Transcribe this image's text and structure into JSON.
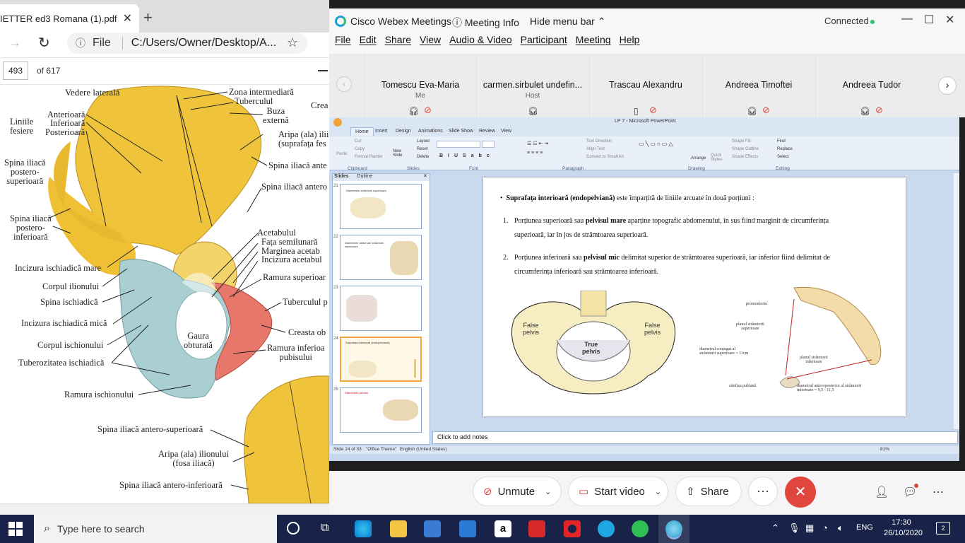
{
  "pdf_viewer": {
    "tab_title": "IETTER ed3 Romana (1).pdf",
    "close_icon": "close-icon",
    "new_tab": "+",
    "address_file_label": "File",
    "address_url": "C:/Users/Owner/Desktop/A...",
    "page_number": "493",
    "page_total": "of 617",
    "figure_labels": {
      "vedere_laterala": "Vedere laterală",
      "zona_intermediara": "Zona intermediară",
      "tuberculul": "Tuberculul",
      "creasta_partial": "Crea",
      "buza_externa": "Buza\nexternă",
      "liniile_fesiere": "Liniile\nfesiere",
      "anterioara": "Anterioară",
      "inferioara": "Inferioară",
      "posterioara": "Posterioară",
      "aripa_ilium_fesiera": "Aripa (ala) ilii\n(suprafața fes",
      "spina_post_sup": "Spina iliacă\npostero-\nsuperioară",
      "spina_ant_partial": "Spina iliacă ante",
      "spina_antero_partial": "Spina iliacă antero",
      "spina_post_inf": "Spina iliacă\npostero-\ninferioară",
      "acetabulul": "Acetabulul",
      "fata_semilunara": "Fața semilunară",
      "marginea_acetabulului": "Marginea acetab",
      "incizura_acetabulului": "Incizura acetabul",
      "incizura_ischiadica_mare": "Incizura ischiadică mare",
      "ramura_superioara": "Ramura superioar",
      "corpul_ilionului": "Corpul ilionului",
      "spina_ischiadica": "Spina ischiadică",
      "tuberculul_pubian": "Tuberculul p",
      "incizura_ischiadica_mica": "Incizura ischiadică mică",
      "creasta_pubiana": "Creasta ob",
      "gaura_obturata": "Gaura\nobturată",
      "corpul_ischionului": "Corpul ischionului",
      "ramura_inferioara": "Ramura inferioa\npubisului",
      "tuberozitatea_ischiadica": "Tuberozitatea ischiadică",
      "ramura_ischionului": "Ramura ischionului",
      "spina_antero_superioara": "Spina iliacă antero-superioară",
      "aripa_ilionului_fosa": "Aripa (ala) ilionului\n(fosa iliacă)",
      "spina_antero_inferioara": "Spina iliacă antero-inferioară"
    }
  },
  "webex": {
    "app_name": "Cisco Webex Meetings",
    "meeting_info": "Meeting Info",
    "hide_menu_bar": "Hide menu bar",
    "status": "Connected",
    "menu": [
      "File",
      "Edit",
      "Share",
      "View",
      "Audio & Video",
      "Participant",
      "Meeting",
      "Help"
    ],
    "participants": [
      {
        "name": "Tomescu Eva-Maria",
        "role": "Me",
        "icon": "headset-icon",
        "muted": true
      },
      {
        "name": "carmen.sirbulet undefin...",
        "role": "Host",
        "icon": "headset-share-icon",
        "muted": false
      },
      {
        "name": "Trascau Alexandru",
        "role": "",
        "icon": "phone-icon",
        "muted": true
      },
      {
        "name": "Andreea Timoftei",
        "role": "",
        "icon": "headset-icon",
        "muted": true
      },
      {
        "name": "Andreea Tudor",
        "role": "",
        "icon": "headset-icon",
        "muted": true
      }
    ],
    "controls": {
      "unmute": "Unmute",
      "start_video": "Start video",
      "share": "Share",
      "more": "···",
      "end_icon": "close-icon"
    }
  },
  "powerpoint": {
    "window_title": "LP 7 - Microsoft PowerPoint",
    "ribbon_tabs": [
      "Home",
      "Insert",
      "Design",
      "Animations",
      "Slide Show",
      "Review",
      "View"
    ],
    "ribbon_groups": [
      "Clipboard",
      "Slides",
      "Font",
      "Paragraph",
      "Drawing",
      "Editing"
    ],
    "ribbon_buttons": {
      "paste": "Paste",
      "cut": "Cut",
      "copy": "Copy",
      "format_painter": "Format Painter",
      "new_slide": "New\nSlide",
      "layout": "Layout",
      "reset": "Reset",
      "delete": "Delete",
      "text_direction": "Text Direction",
      "align_text": "Align Text",
      "convert_smartart": "Convert to SmartArt",
      "arrange": "Arrange",
      "quick_styles": "Quick\nStyles",
      "shape_fill": "Shape Fill",
      "shape_outline": "Shape Outline",
      "shape_effects": "Shape Effects",
      "find": "Find",
      "replace": "Replace",
      "select": "Select"
    },
    "pane_tabs": [
      "Slides",
      "Outline"
    ],
    "thumbnails": [
      {
        "num": "21",
        "title": "Diametrele strâmtorii superioare"
      },
      {
        "num": "22",
        "title": "Diametrele oblice ale strâmtorii superioare"
      },
      {
        "num": "23",
        "title": ""
      },
      {
        "num": "24",
        "title": "Suprafața interioară (endopelviană)",
        "selected": true
      },
      {
        "num": "25",
        "title": "Diferențele pelvine"
      }
    ],
    "slide": {
      "bullet": "•",
      "p1_bold": "Suprafața interioară (endopelviană)",
      "p1_rest": "este împarțită de liniile arcuate în două porțiuni :",
      "item1_num": "1.",
      "item1_a": "Porțiunea superioară sau",
      "item1_bold": "pelvisul mare",
      "item1_b": "aparține topografic abdomenului, în sus fiind marginit de circumferința",
      "item1_c": "superioară, iar în jos de strâmtoarea superioară.",
      "item2_num": "2.",
      "item2_a": "Porțiunea inferioară sau",
      "item2_bold": "pelvisul mic",
      "item2_b": "delimitat superior de strâmtoarea superioară, iar inferior fiind delimitat de",
      "item2_c": "circumferința inferioară sau strâmtoarea inferioară.",
      "img1": {
        "false_pelvis_l": "False\npelvis",
        "false_pelvis_r": "False\npelvis",
        "true_pelvis": "True\npelvis"
      },
      "img2": {
        "promontoriu": "promontoriu",
        "planul_sup": "planul strâmtorii\nsuperioare",
        "diametrul": "diametrul conjugat al\nstrâmtorii superioare = 11cm",
        "planul_inf": "planul strâmtorii\ninferioare",
        "simfiza": "simfiza pubiană",
        "diametrul_ap": "diametrul anteroposterior al strâmtorii\ninferioare = 9,5 - 11,5"
      }
    },
    "notes_placeholder": "Click to add notes",
    "status": {
      "slide_of": "Slide 24 of 33",
      "theme": "\"Office Theme\"",
      "language": "English (United States)",
      "zoom": "81%"
    }
  },
  "taskbar": {
    "search_placeholder": "Type here to search",
    "language": "ENG",
    "time": "17:30",
    "date": "26/10/2020",
    "notifications": "2"
  }
}
